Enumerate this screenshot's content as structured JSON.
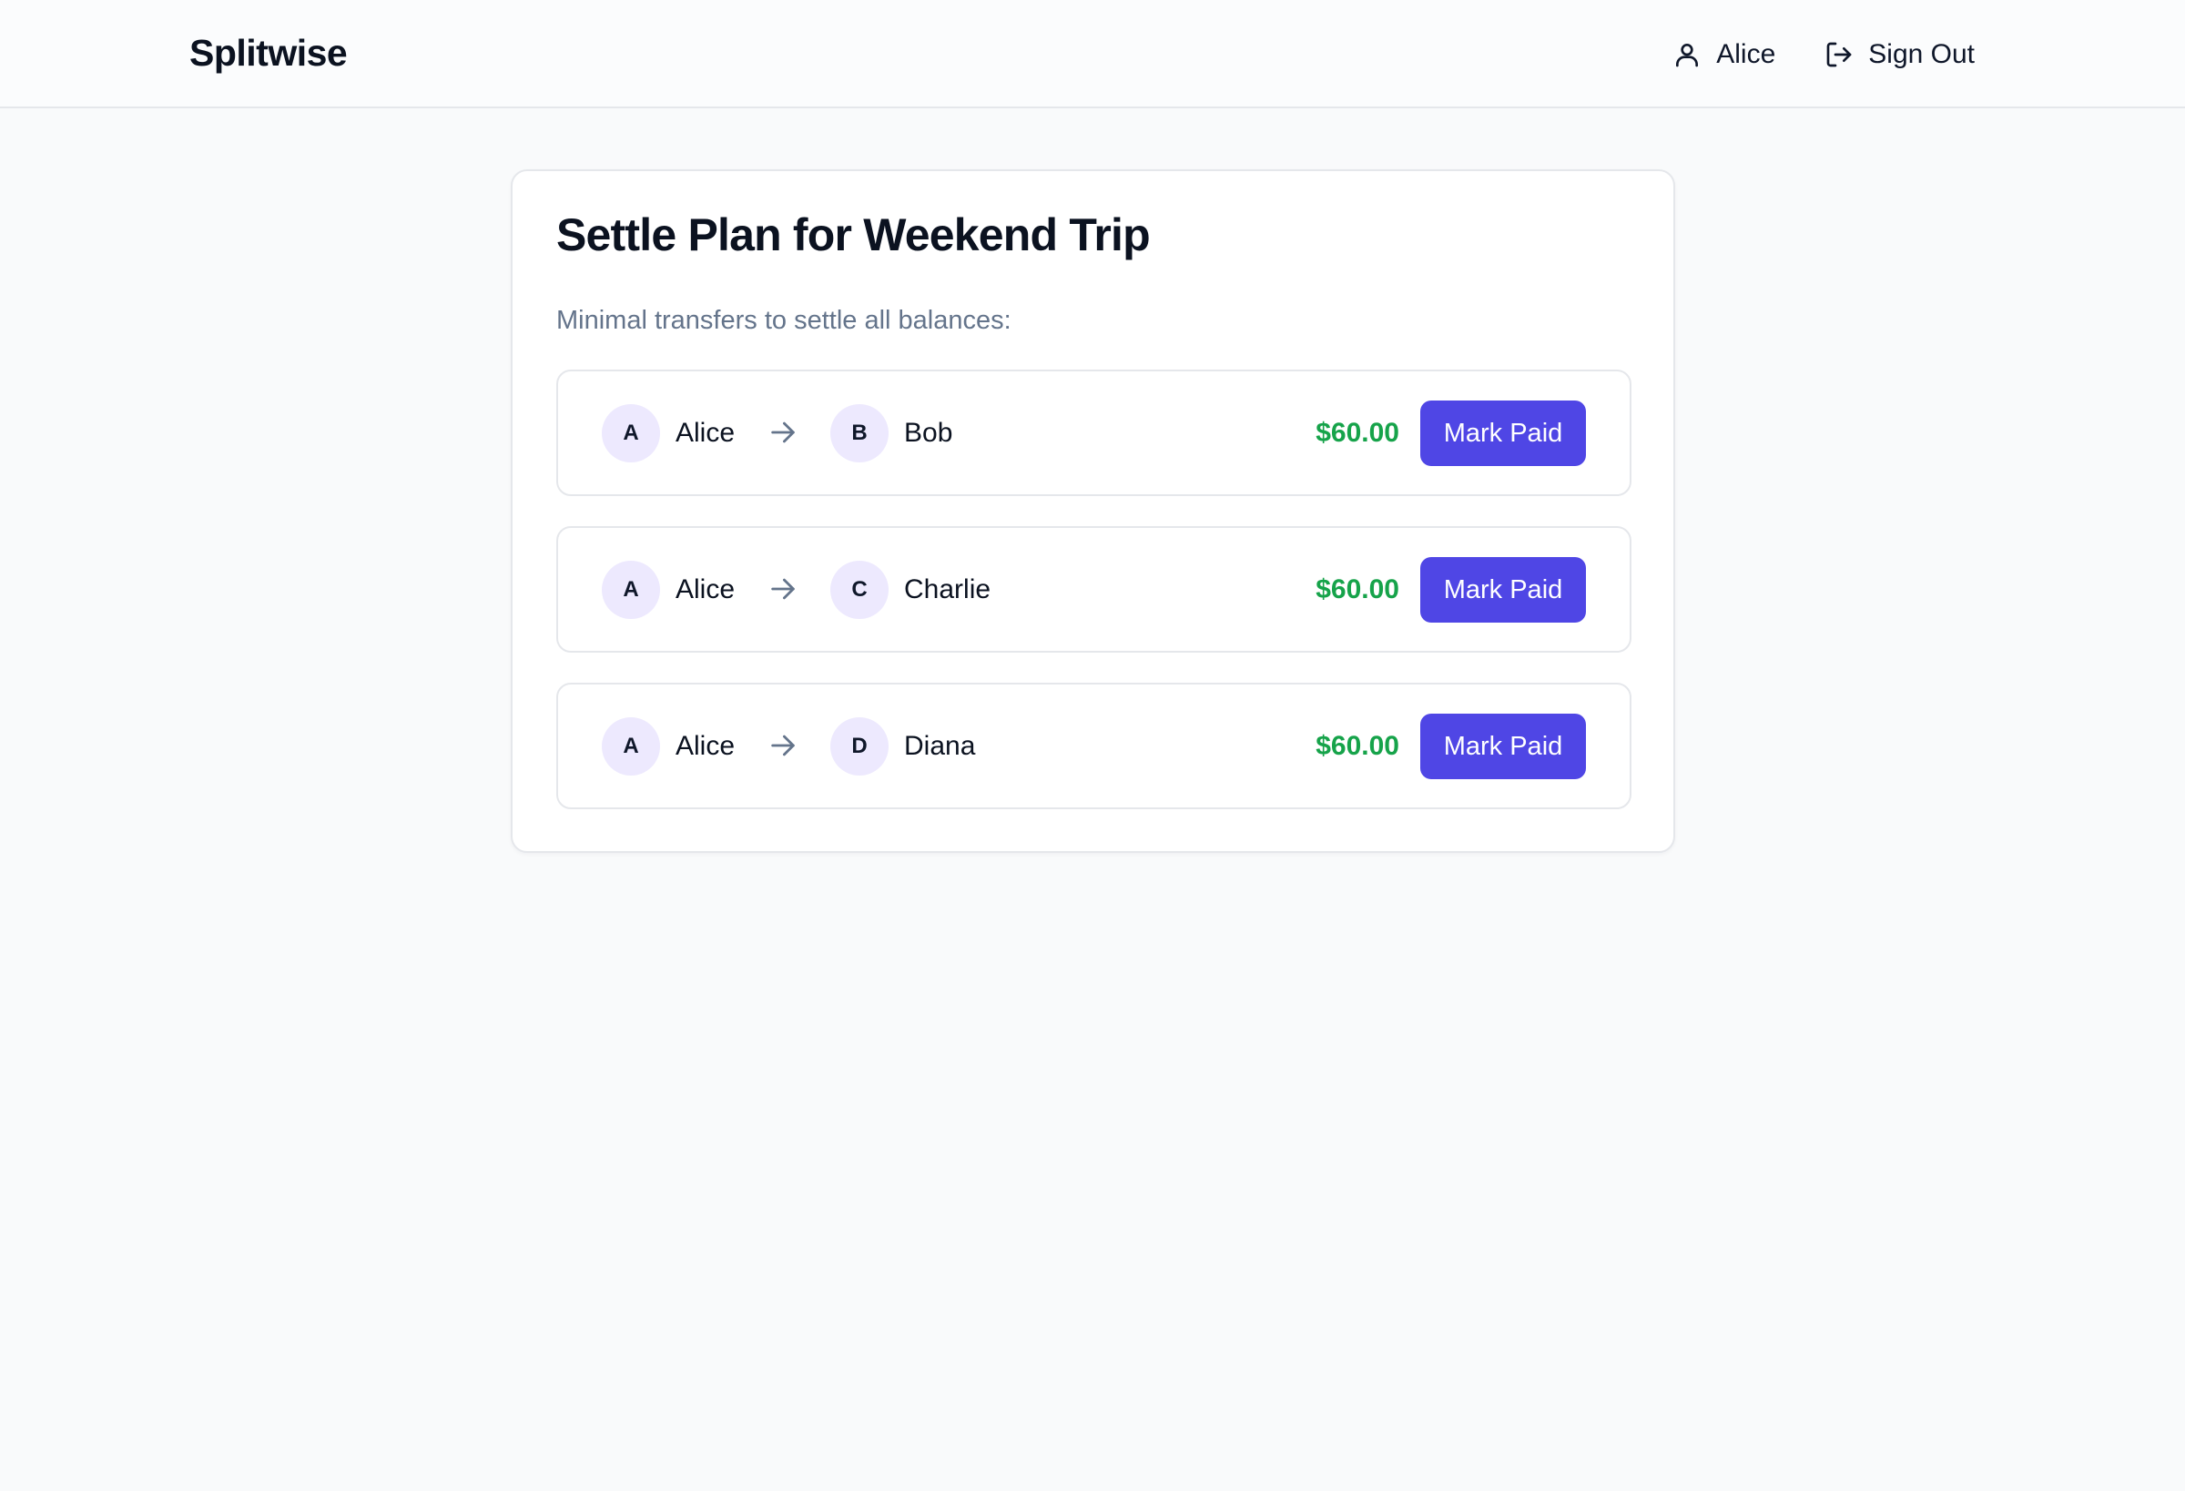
{
  "header": {
    "brand": "Splitwise",
    "user_name": "Alice",
    "sign_out_label": "Sign Out",
    "user_icon": "user-icon",
    "sign_out_icon": "sign-out-icon"
  },
  "settle": {
    "title": "Settle Plan for Weekend Trip",
    "subtitle": "Minimal transfers to settle all balances:",
    "transfers": [
      {
        "from_initial": "A",
        "from_name": "Alice",
        "to_initial": "B",
        "to_name": "Bob",
        "amount": "$60.00",
        "action_label": "Mark Paid"
      },
      {
        "from_initial": "A",
        "from_name": "Alice",
        "to_initial": "C",
        "to_name": "Charlie",
        "amount": "$60.00",
        "action_label": "Mark Paid"
      },
      {
        "from_initial": "A",
        "from_name": "Alice",
        "to_initial": "D",
        "to_name": "Diana",
        "amount": "$60.00",
        "action_label": "Mark Paid"
      }
    ]
  },
  "colors": {
    "accent": "#4f46e5",
    "amount_green": "#16a34a",
    "avatar_bg": "#ede9fe",
    "muted_text": "#64748b",
    "page_bg": "#f9fafb"
  }
}
